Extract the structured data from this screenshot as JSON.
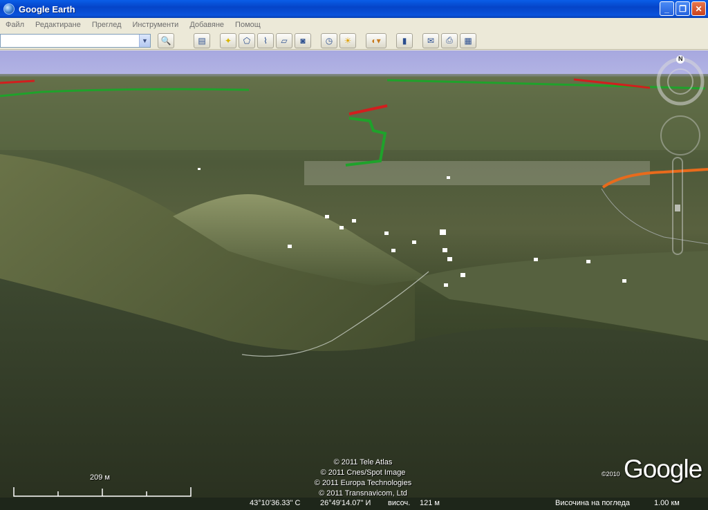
{
  "window": {
    "title": "Google Earth",
    "minimize_glyph": "_",
    "maximize_glyph": "❐",
    "close_glyph": "✕"
  },
  "menu": {
    "items": [
      "Файл",
      "Редактиране",
      "Преглед",
      "Инструменти",
      "Добавяне",
      "Помощ"
    ]
  },
  "toolbar": {
    "search_value": "",
    "icons": [
      "sidebar-icon",
      "placemark-icon",
      "polygon-icon",
      "path-icon",
      "overlay-icon",
      "tour-icon",
      "historical-imagery-icon",
      "sunlight-icon",
      "planets-icon",
      "ruler-icon",
      "email-icon",
      "print-icon",
      "view-in-maps-icon"
    ]
  },
  "map": {
    "copyright": [
      "© 2011 Tele Atlas",
      "© 2011 Cnes/Spot Image",
      "© 2011 Europa Technologies",
      "© 2011 Transnavicom, Ltd"
    ],
    "logo_year": "©2010",
    "logo_text": "Google",
    "scale_label": "209 м",
    "compass_north": "N"
  },
  "status": {
    "latitude": "43°10'36.33\" С",
    "longitude": "26°49'14.07\" И",
    "elevation_label": "височ.",
    "elevation_value": "121 м",
    "eye_alt_label": "Височина на погледа",
    "eye_alt_value": "1.00 км"
  },
  "colors": {
    "title_bar": "#0a5ee8",
    "sky": "#a7a8df",
    "border_green": "#1fa22b",
    "border_red": "#d21e1e",
    "road_orange": "#e86b1c",
    "status_bar": "#1e261a"
  }
}
